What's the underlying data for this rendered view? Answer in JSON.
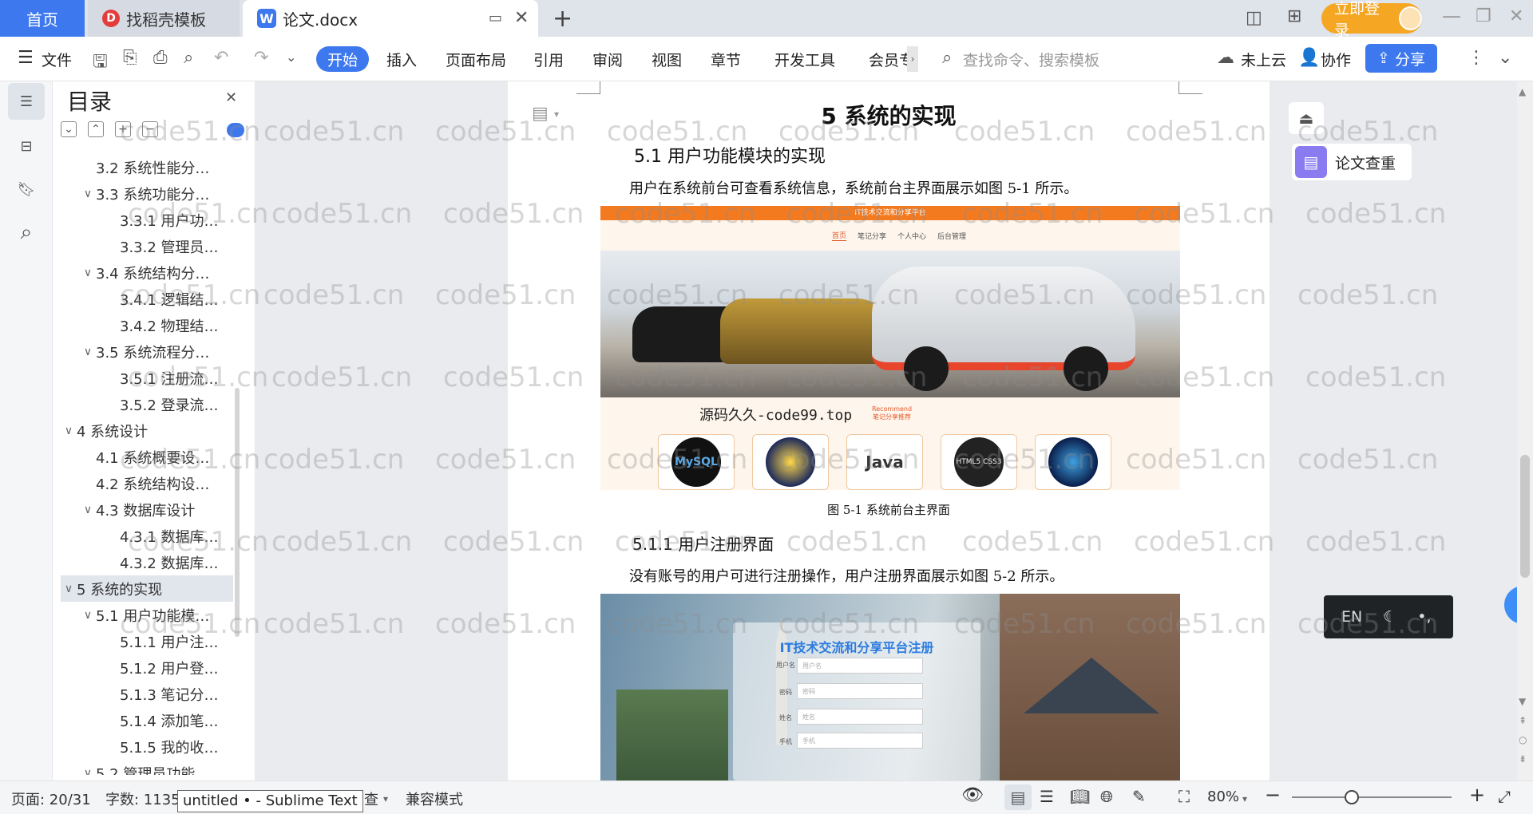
{
  "tabs": {
    "home": "首页",
    "template": "找稻壳模板",
    "doc": "论文.docx",
    "login": "立即登录"
  },
  "menu": {
    "file": "文件",
    "start": "开始",
    "insert": "插入",
    "layout": "页面布局",
    "references": "引用",
    "review": "审阅",
    "view": "视图",
    "chapter": "章节",
    "devtools": "开发工具",
    "member": "会员专",
    "search_placeholder": "查找命令、搜索模板",
    "cloud": "未上云",
    "collab": "协作",
    "share": "分享"
  },
  "toc": {
    "title": "目录",
    "items": [
      {
        "label": "3.2 系统性能分…",
        "level": 2,
        "chev": ""
      },
      {
        "label": "3.3 系统功能分…",
        "level": 2,
        "chev": "∨"
      },
      {
        "label": "3.3.1 用户功…",
        "level": 3,
        "chev": ""
      },
      {
        "label": "3.3.2 管理员…",
        "level": 3,
        "chev": ""
      },
      {
        "label": "3.4  系统结构分…",
        "level": 2,
        "chev": "∨"
      },
      {
        "label": "3.4.1 逻辑结…",
        "level": 3,
        "chev": ""
      },
      {
        "label": "3.4.2 物理结…",
        "level": 3,
        "chev": ""
      },
      {
        "label": "3.5  系统流程分…",
        "level": 2,
        "chev": "∨"
      },
      {
        "label": "3.5.1 注册流…",
        "level": 3,
        "chev": ""
      },
      {
        "label": "3.5.2 登录流…",
        "level": 3,
        "chev": ""
      },
      {
        "label": "4  系统设计",
        "level": 1,
        "chev": "∨"
      },
      {
        "label": "4.1 系统概要设…",
        "level": 2,
        "chev": ""
      },
      {
        "label": "4.2 系统结构设…",
        "level": 2,
        "chev": ""
      },
      {
        "label": "4.3  数据库设计",
        "level": 2,
        "chev": "∨"
      },
      {
        "label": "4.3.1  数据库…",
        "level": 3,
        "chev": ""
      },
      {
        "label": "4.3.2  数据库…",
        "level": 3,
        "chev": ""
      },
      {
        "label": "5  系统的实现",
        "level": 1,
        "chev": "∨"
      },
      {
        "label": "5.1  用户功能模…",
        "level": 2,
        "chev": "∨"
      },
      {
        "label": "5.1.1 用户注…",
        "level": 3,
        "chev": ""
      },
      {
        "label": "5.1.2 用户登…",
        "level": 3,
        "chev": ""
      },
      {
        "label": "5.1.3 笔记分…",
        "level": 3,
        "chev": ""
      },
      {
        "label": "5.1.4 添加笔…",
        "level": 3,
        "chev": ""
      },
      {
        "label": "5.1.5 我的收…",
        "level": 3,
        "chev": ""
      },
      {
        "label": "5.2  管理员功能…",
        "level": 2,
        "chev": "∨"
      }
    ]
  },
  "doc": {
    "chapter_title": "5  系统的实现",
    "section_title": "5.1  用户功能模块的实现",
    "para1": "用户在系统前台可查看系统信息，系统前台主界面展示如图 5-1 所示。",
    "fig1": {
      "banner": "IT技术交流和分享平台",
      "nav": [
        "首页",
        "笔记分享",
        "个人中心",
        "后台管理"
      ],
      "watermark_text": "源码久久-code99.top",
      "recommend": "Recommend",
      "recommend_sub": "笔记分享推荐",
      "thumbs": [
        "MySQL",
        "",
        "Java",
        "HTML5 CSS3",
        ""
      ]
    },
    "fig1_caption": "图 5-1 系统前台主界面",
    "subsection_title": "5.1.1 用户注册界面",
    "para2": "没有账号的用户可进行注册操作，用户注册界面展示如图 5-2 所示。",
    "fig2": {
      "form_title": "IT技术交流和分享平台注册",
      "labels": [
        "用户名",
        "密码",
        "姓名",
        "手机"
      ],
      "placeholders": [
        "用户名",
        "密码",
        "姓名",
        "手机"
      ]
    }
  },
  "side": {
    "plagiarism": "论文查重",
    "ime_lang": "EN"
  },
  "watermark": "code51.cn",
  "status": {
    "page": "页面: 20/31",
    "words": "字数: 1135",
    "tooltip": "untitled • - Sublime Text",
    "check": "检查",
    "compat": "兼容模式",
    "zoom": "80%"
  }
}
